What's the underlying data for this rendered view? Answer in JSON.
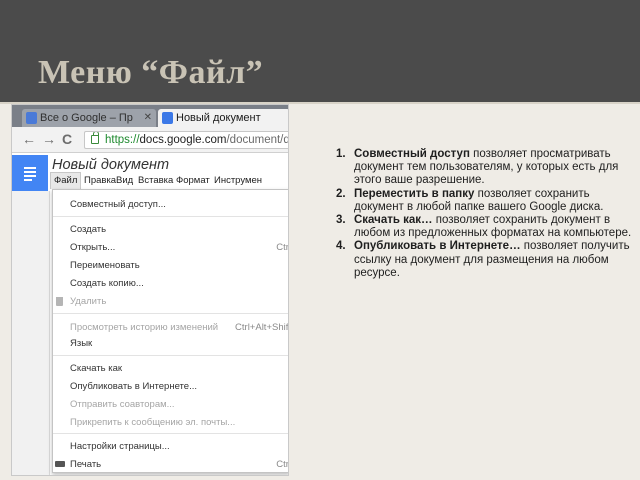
{
  "slide": {
    "title": "Меню “Файл”"
  },
  "browser": {
    "tabs": [
      {
        "label": "Все о Google – Пр"
      },
      {
        "label": "Новый документ"
      }
    ],
    "nav": {
      "back": "←",
      "forward": "→",
      "reload": "C"
    },
    "url": {
      "scheme": "https://",
      "host": "docs.google.com",
      "path": "/document/d/"
    }
  },
  "docs": {
    "title": "Новый документ",
    "menu": [
      "Файл",
      "Правка",
      "Вид",
      "Вставка",
      "Формат",
      "Инструмен"
    ]
  },
  "file_menu": {
    "items": [
      {
        "label": "Совместный доступ...",
        "shortcut": ""
      },
      {
        "label": "Создать",
        "shortcut": ""
      },
      {
        "label": "Открыть...",
        "shortcut": "Ctrl"
      },
      {
        "label": "Переименовать",
        "shortcut": ""
      },
      {
        "label": "Создать копию...",
        "shortcut": ""
      },
      {
        "label": "Удалить",
        "shortcut": ""
      },
      {
        "label": "Просмотреть историю изменений",
        "shortcut": "Ctrl+Alt+Shift"
      },
      {
        "label": "Язык",
        "shortcut": ""
      },
      {
        "label": "Скачать как",
        "shortcut": ""
      },
      {
        "label": "Опубликовать в Интернете...",
        "shortcut": ""
      },
      {
        "label": "Отправить соавторам...",
        "shortcut": ""
      },
      {
        "label": "Прикрепить к сообщению эл. почты...",
        "shortcut": ""
      },
      {
        "label": "Настройки страницы...",
        "shortcut": ""
      },
      {
        "label": "Печать",
        "shortcut": "Ctrl"
      }
    ]
  },
  "notes": [
    {
      "num": "1.",
      "bold": "Совместный доступ",
      "text": " позволяет просматривать документ тем пользователям, у которых есть для этого ваше разрешение."
    },
    {
      "num": "2.",
      "bold": "Переместить в папку",
      "text": " позволяет сохранить документ в любой папке вашего Google диска."
    },
    {
      "num": "3.",
      "bold": "Скачать как…",
      "text": " позволяет сохранить документ в любом из предложенных форматах на компьютере."
    },
    {
      "num": "4.",
      "bold": "Опубликовать в Интернете…",
      "text": " позволяет получить ссылку на документ для размещения на любом ресурсе."
    }
  ]
}
